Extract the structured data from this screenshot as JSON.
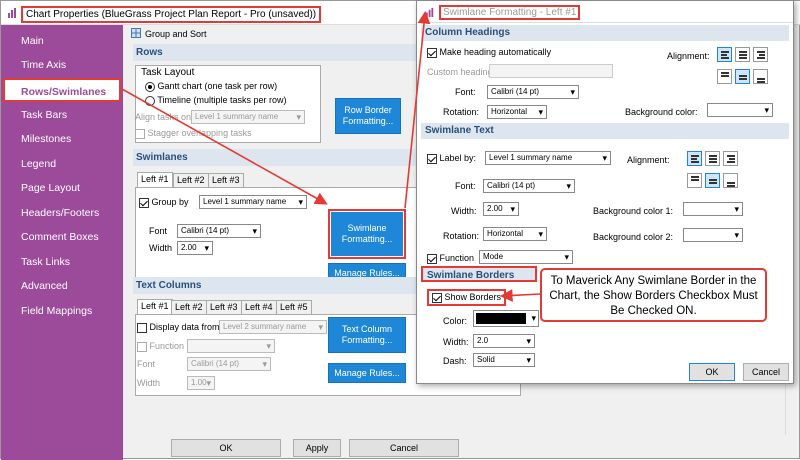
{
  "window": {
    "title": "Chart Properties (BlueGrass Project Plan Report - Pro (unsaved))",
    "bottom_ok": "OK",
    "bottom_apply": "Apply",
    "bottom_cancel": "Cancel"
  },
  "sidebar": {
    "items": [
      {
        "label": "Main"
      },
      {
        "label": "Time Axis"
      },
      {
        "label": "Rows/Swimlanes"
      },
      {
        "label": "Task Bars"
      },
      {
        "label": "Milestones"
      },
      {
        "label": "Legend"
      },
      {
        "label": "Page Layout"
      },
      {
        "label": "Headers/Footers"
      },
      {
        "label": "Comment Boxes"
      },
      {
        "label": "Task Links"
      },
      {
        "label": "Advanced"
      },
      {
        "label": "Field Mappings"
      }
    ],
    "active_index": 2
  },
  "main": {
    "group_sort": "Group and Sort",
    "rows": {
      "heading": "Rows",
      "task_layout": "Task Layout",
      "gantt": "Gantt chart (one task per row)",
      "timeline": "Timeline (multiple tasks per row)",
      "align_label": "Align tasks on",
      "align_value": "Level 1 summary name",
      "stagger": "Stagger overlapping tasks",
      "row_border_btn": "Row Border Formatting..."
    },
    "swimlanes": {
      "heading": "Swimlanes",
      "tabs": [
        "Left #1",
        "Left #2",
        "Left #3"
      ],
      "group_by_label": "Group by",
      "group_by_value": "Level 1 summary name",
      "font_label": "Font",
      "font_value": "Calibri (14 pt)",
      "width_label": "Width",
      "width_value": "2.00",
      "format_btn": "Swimlane Formatting...",
      "manage_btn": "Manage Rules..."
    },
    "text_columns": {
      "heading": "Text Columns",
      "tabs": [
        "Left #1",
        "Left #2",
        "Left #3",
        "Left #4",
        "Left #5"
      ],
      "display_label": "Display data from",
      "display_value": "Level 2 summary name",
      "function_label": "Function",
      "font_label": "Font",
      "font_value": "Calibri (14 pt)",
      "width_label": "Width",
      "width_value": "1.00",
      "format_btn": "Text Column Formatting...",
      "manage_btn": "Manage Rules..."
    }
  },
  "dialog": {
    "title": "Swimlane Formatting - Left #1",
    "column_headings": {
      "heading": "Column Headings",
      "make_auto": "Make heading automatically",
      "custom_label": "Custom heading:",
      "font_label": "Font:",
      "font_value": "Calibri (14 pt)",
      "rotation_label": "Rotation:",
      "rotation_value": "Horizontal",
      "alignment_label": "Alignment:",
      "bg_label": "Background color:"
    },
    "swimlane_text": {
      "heading": "Swimlane Text",
      "label_by": "Label by:",
      "label_by_value": "Level 1 summary name",
      "alignment_label": "Alignment:",
      "font_label": "Font:",
      "font_value": "Calibri (14 pt)",
      "width_label": "Width:",
      "width_value": "2.00",
      "bg1_label": "Background color 1:",
      "rotation_label": "Rotation:",
      "rotation_value": "Horizontal",
      "bg2_label": "Background color 2:",
      "function_label": "Function",
      "function_value": "Mode"
    },
    "swimlane_borders": {
      "heading": "Swimlane Borders",
      "show_borders": "Show Borders",
      "color_label": "Color:",
      "width_label": "Width:",
      "width_value": "2.0",
      "dash_label": "Dash:",
      "dash_value": "Solid"
    },
    "ok": "OK",
    "cancel": "Cancel"
  },
  "callout": {
    "text": "To Maverick Any Swimlane Border in the Chart, the Show Borders Checkbox Must Be Checked ON."
  },
  "colors": {
    "sidebar": "#9c4a9a",
    "accent_button": "#1e87d8",
    "annotation": "#e53935",
    "section_header": "#dde6ef",
    "border_color": "#000000"
  }
}
